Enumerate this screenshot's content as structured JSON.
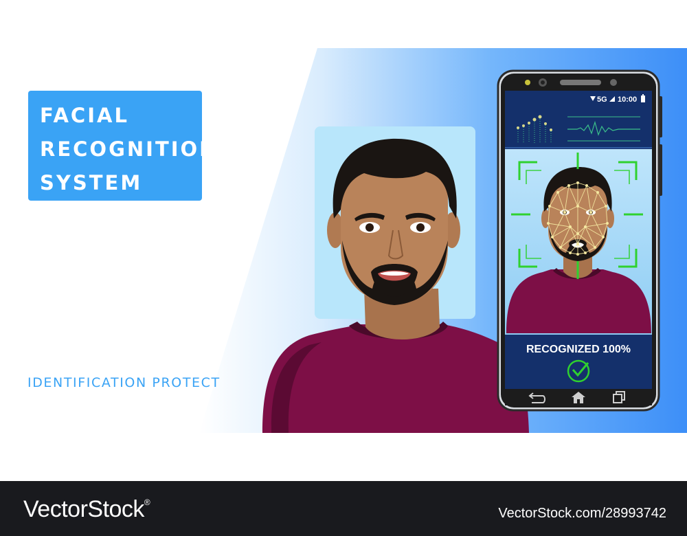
{
  "banner": {
    "title_lines": [
      "FACIAL",
      "RECOGNITION",
      "SYSTEM"
    ],
    "subtitle": "IDENTIFICATION PROTECT"
  },
  "phone": {
    "status": {
      "network": "5G",
      "time": "10:00"
    },
    "result_text": "RECOGNIZED 100%"
  },
  "footer": {
    "brand": "VectorStock",
    "registered_mark": "®",
    "image_id": "VectorStock.com/28993742"
  },
  "colors": {
    "accent_blue": "#3aa3f5",
    "screen_navy": "#14306b",
    "scan_green": "#2fd12f",
    "shirt": "#7d0f46",
    "footer_bg": "#191a1e"
  },
  "icons": [
    "wifi-icon",
    "signal-icon",
    "battery-icon",
    "back-icon",
    "home-icon",
    "recent-apps-icon",
    "check-icon"
  ]
}
